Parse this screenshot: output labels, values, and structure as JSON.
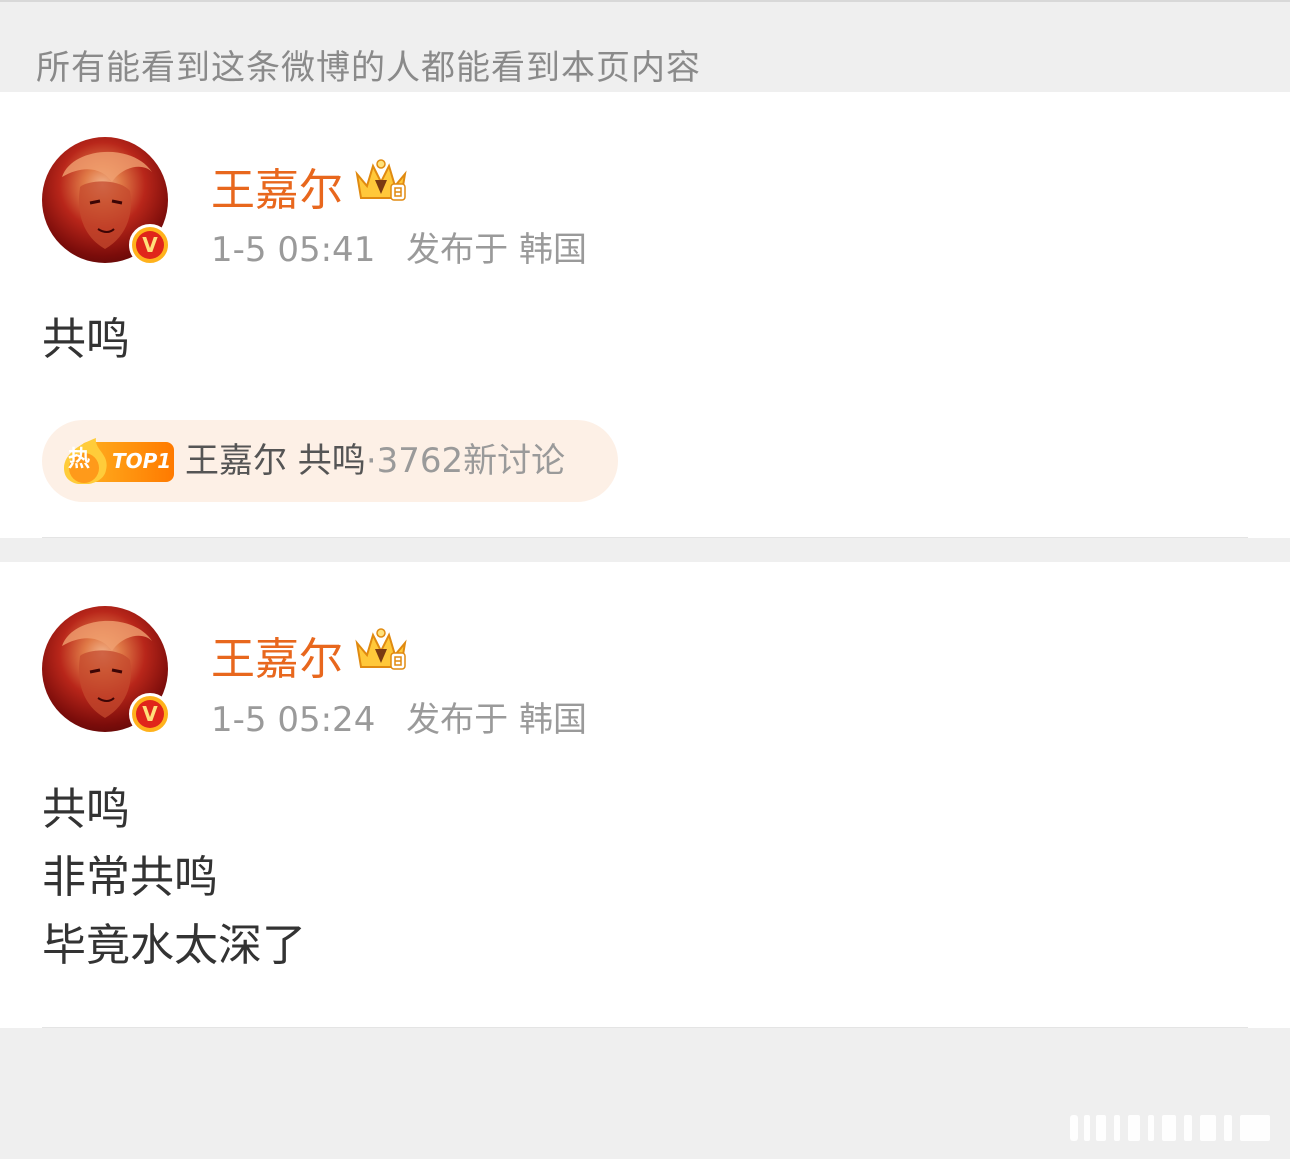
{
  "notice": "所有能看到这条微博的人都能看到本页内容",
  "posts": [
    {
      "author": "王嘉尔",
      "time": "1-5 05:41",
      "location": "发布于 韩国",
      "lines": [
        "共鸣"
      ],
      "topic": {
        "badge_hot": "热",
        "badge_rank": "TOP1",
        "title": "王嘉尔 共鸣",
        "count": "·3762新讨论"
      }
    },
    {
      "author": "王嘉尔",
      "time": "1-5 05:24",
      "location": "发布于 韩国",
      "lines": [
        "共鸣",
        "非常共鸣",
        "毕竟水太深了"
      ]
    }
  ],
  "icons": {
    "avatar": "avatar-photo",
    "verified": "verified-v-badge-icon",
    "vip": "crown-vip-icon",
    "hot": "hot-flame-icon"
  },
  "colors": {
    "author_name": "#e8671d",
    "meta": "#9a9a9a",
    "topic_bg": "#fdf0e6",
    "hot_tag": "#ff8a00"
  }
}
